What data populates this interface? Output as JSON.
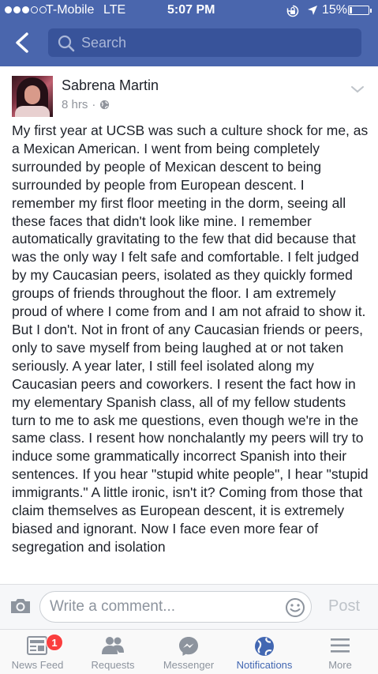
{
  "status_bar": {
    "carrier": "T-Mobile",
    "network": "LTE",
    "time": "5:07 PM",
    "battery": "15%",
    "battery_level": 0.15,
    "signal_bars": 3
  },
  "nav": {
    "search_placeholder": "Search"
  },
  "post": {
    "author": "Sabrena Martin",
    "time": "8 hrs",
    "separator": "·",
    "audience_icon": "globe-icon",
    "body": "My first year at UCSB was such a culture shock for me, as a Mexican American. I went from being completely surrounded by people of Mexican descent to being surrounded by people from European descent. I remember my first floor meeting in the dorm, seeing all these faces that didn't look like mine. I remember automatically gravitating to the few that did because that was the only way I felt safe and comfortable. I felt judged by my Caucasian peers, isolated as they quickly formed groups of friends throughout the floor. I am extremely proud of where I come from and I am not afraid to show it. But I don't. Not in front of any Caucasian friends or peers, only to save myself from being laughed at or not taken seriously. A year later, I still feel isolated along my Caucasian peers and coworkers. I resent the fact how in my elementary Spanish class, all of my fellow students turn to me to ask me questions, even though we're in the same class. I resent how nonchalantly my peers will try to induce some grammatically incorrect Spanish into their sentences. If you hear \"stupid white people\", I hear \"stupid immigrants.\" A little ironic, isn't it? Coming from those that claim themselves as European descent, it is extremely biased and ignorant. Now I face even more fear of segregation and isolation"
  },
  "comment_bar": {
    "placeholder": "Write a comment...",
    "post_label": "Post"
  },
  "tabs": [
    {
      "label": "News Feed",
      "icon": "news-feed-icon",
      "badge": "1"
    },
    {
      "label": "Requests",
      "icon": "friend-requests-icon"
    },
    {
      "label": "Messenger",
      "icon": "messenger-icon"
    },
    {
      "label": "Notifications",
      "icon": "globe-icon",
      "active": true
    },
    {
      "label": "More",
      "icon": "menu-icon"
    }
  ],
  "colors": {
    "brand": "#4a66ad",
    "active_tab": "#4267b2",
    "badge": "#fa3e3e"
  }
}
